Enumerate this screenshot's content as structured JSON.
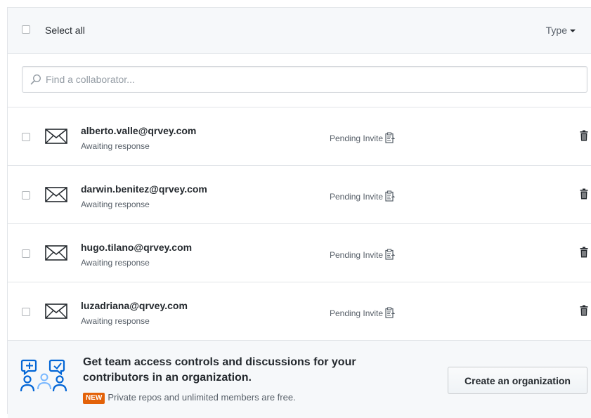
{
  "header": {
    "select_all_label": "Select all",
    "type_filter_label": "Type"
  },
  "search": {
    "placeholder": "Find a collaborator..."
  },
  "collaborators": [
    {
      "email": "alberto.valle@qrvey.com",
      "status_sub": "Awaiting response",
      "status": "Pending Invite"
    },
    {
      "email": "darwin.benitez@qrvey.com",
      "status_sub": "Awaiting response",
      "status": "Pending Invite"
    },
    {
      "email": "hugo.tilano@qrvey.com",
      "status_sub": "Awaiting response",
      "status": "Pending Invite"
    },
    {
      "email": "luzadriana@qrvey.com",
      "status_sub": "Awaiting response",
      "status": "Pending Invite"
    }
  ],
  "promo": {
    "title": "Get team access controls and discussions for your contributors in an organization.",
    "badge": "NEW",
    "note": "Private repos and unlimited members are free.",
    "button_label": "Create an organization"
  },
  "colors": {
    "badge_bg": "#e36209",
    "header_bg": "#f6f8fa",
    "promo_icon": "#0366d6"
  },
  "icons": {
    "search": "search-icon",
    "mail": "mail-icon",
    "clipboard": "clipboard-icon",
    "trash": "trash-icon",
    "team": "team-collaboration-icon"
  }
}
